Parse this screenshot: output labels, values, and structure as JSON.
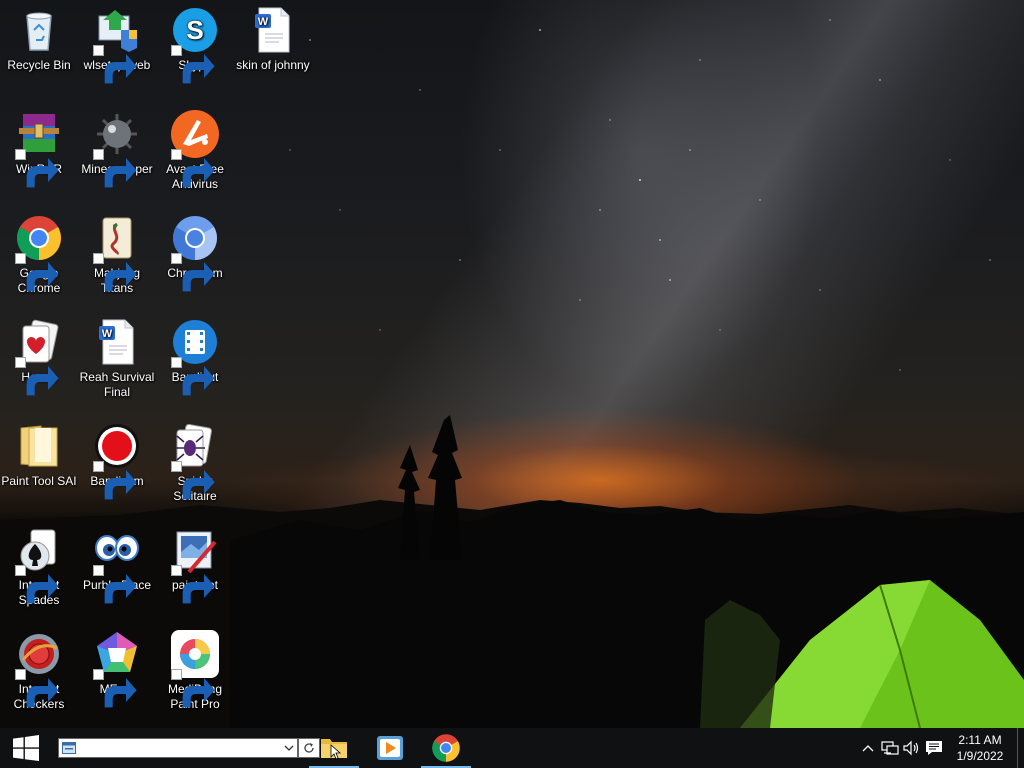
{
  "desktop": {
    "icons": [
      {
        "label": "Recycle Bin",
        "icon": "recycle-bin-icon"
      },
      {
        "label": "WinRAR",
        "icon": "winrar-icon"
      },
      {
        "label": "Google Chrome",
        "icon": "chrome-icon"
      },
      {
        "label": "skin of johnny",
        "icon": "word-document-icon"
      },
      {
        "label": "Hearts",
        "icon": "hearts-icon"
      },
      {
        "label": "Paint Tool SAI",
        "icon": "folder-icon"
      },
      {
        "label": "Internet Spades",
        "icon": "spades-icon"
      },
      {
        "label": "Internet Checkers",
        "icon": "checkers-icon"
      },
      {
        "label": "wlsetup-web",
        "icon": "wlsetup-icon"
      },
      {
        "label": "Minesweeper",
        "icon": "minesweeper-icon"
      },
      {
        "label": "Mahjong Titans",
        "icon": "mahjong-icon"
      },
      {
        "label": "Reah Survival Final",
        "icon": "word-document-icon"
      },
      {
        "label": "Bandicam",
        "icon": "bandicam-icon"
      },
      {
        "label": "Purble Place",
        "icon": "purble-place-icon"
      },
      {
        "label": "MEmu",
        "icon": "memu-icon"
      },
      {
        "label": "Skype",
        "icon": "skype-icon"
      },
      {
        "label": "Avast Free Antivirus",
        "icon": "avast-icon"
      },
      {
        "label": "Chromium",
        "icon": "chromium-icon"
      },
      {
        "label": "Bandicut",
        "icon": "bandicut-icon"
      },
      {
        "label": "Spider Solitaire",
        "icon": "spider-solitaire-icon"
      },
      {
        "label": "paint.net",
        "icon": "paintnet-icon"
      },
      {
        "label": "MediBang Paint Pro",
        "icon": "medibang-icon"
      }
    ]
  },
  "taskbar": {
    "address_value": "",
    "apps": [
      {
        "name": "File Explorer",
        "icon": "file-explorer-icon",
        "running": true
      },
      {
        "name": "Media Player",
        "icon": "media-player-icon",
        "running": false
      },
      {
        "name": "Google Chrome",
        "icon": "chrome-icon",
        "running": true
      }
    ],
    "clock": {
      "time": "2:11 AM",
      "date": "1/9/2022"
    }
  },
  "colors": {
    "taskbar_bg": "#101112",
    "running_indicator": "#76b9ed",
    "tent_green": "#7ed321"
  }
}
